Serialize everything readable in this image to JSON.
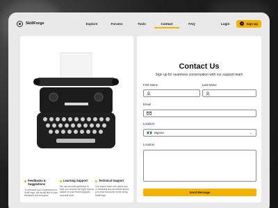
{
  "colors": {
    "accent": "#f5b301",
    "flag_green": "#0a8a3a"
  },
  "brand": {
    "name": "SkillForge"
  },
  "nav": {
    "links": [
      {
        "label": "Explore"
      },
      {
        "label": "Forums"
      },
      {
        "label": "Tools"
      },
      {
        "label": "Contact"
      },
      {
        "label": "FAQ"
      }
    ],
    "active": "Contact",
    "login_label": "Login",
    "signup_label": "Sign Up",
    "signup_icon_text": "S"
  },
  "features": [
    {
      "title": "Feedbacks & Suggestions",
      "description": "To enhance your experience on SkillForge, we would like to your feedback and thoughts."
    },
    {
      "title": "Learning Support",
      "description": "We can provide guidance to help you choose the right course based on your learning goals and skill level."
    },
    {
      "title": "Technical Support",
      "description": "Our expert team can assist you in resolving any technical issues you may encounter while using SkillForge."
    }
  ],
  "contact": {
    "title": "Contact Us",
    "subtitle": "Sign up for seamless conversation with our support team",
    "first_name_label": "First Name",
    "last_name_label": "Last Name",
    "email_label": "Email",
    "location_label": "Location",
    "location_value": "Nigeria",
    "message_label": "Location",
    "send_label": "Send Message"
  }
}
